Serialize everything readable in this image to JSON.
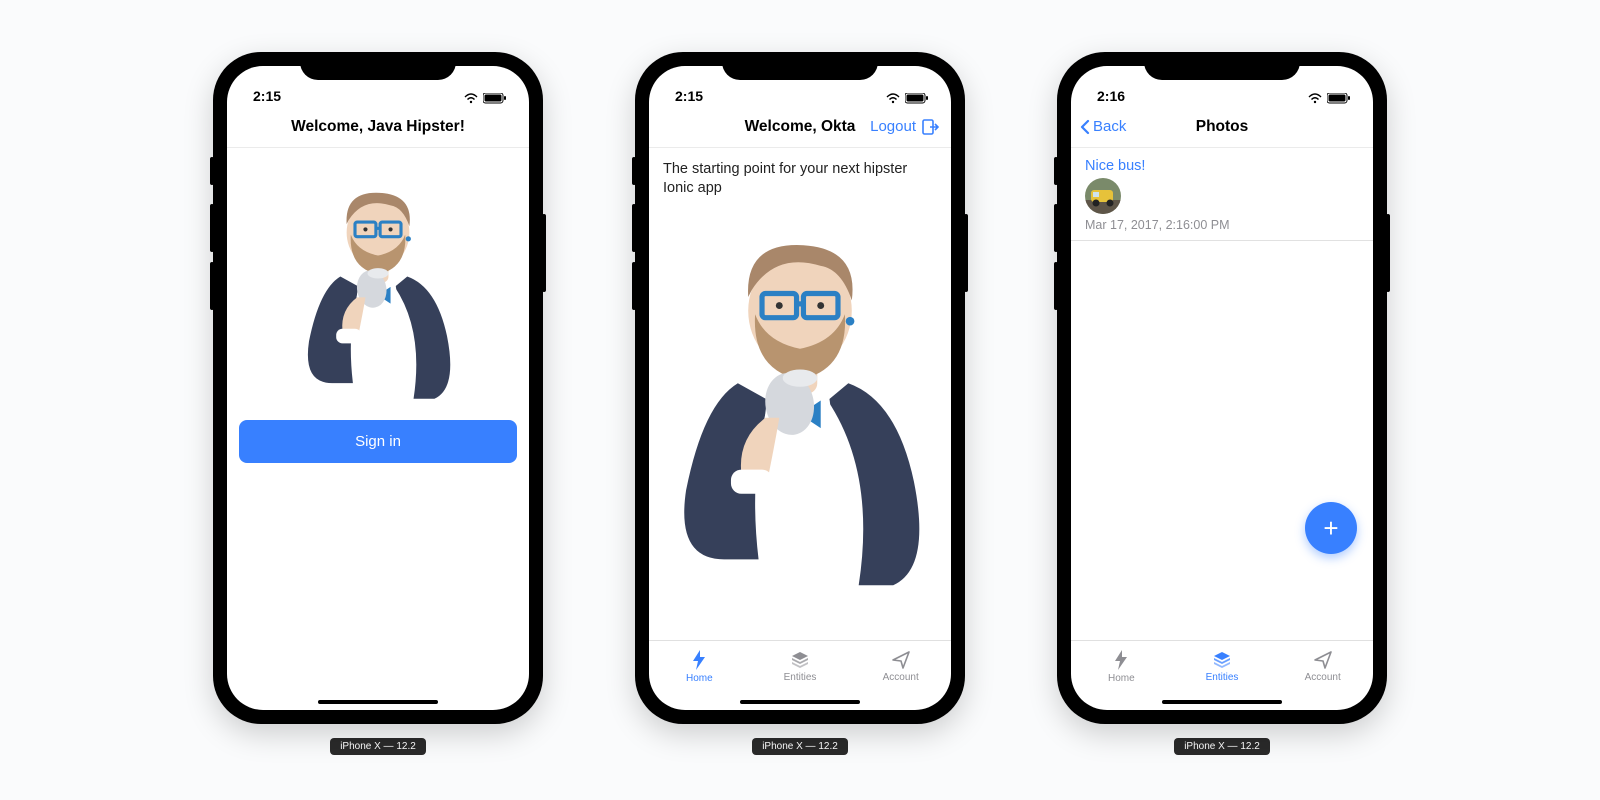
{
  "colors": {
    "accent": "#3880ff",
    "muted": "#8e8e93"
  },
  "device_label": "iPhone X — 12.2",
  "status": {
    "time_a": "2:15",
    "time_b": "2:15",
    "time_c": "2:16"
  },
  "screen1": {
    "title": "Welcome, Java Hipster!",
    "signin_label": "Sign in"
  },
  "screen2": {
    "title": "Welcome, Okta",
    "logout_label": "Logout",
    "subtitle": "The starting point for your next hipster Ionic app",
    "tabs": {
      "home": "Home",
      "entities": "Entities",
      "account": "Account"
    },
    "active_tab": "home"
  },
  "screen3": {
    "back_label": "Back",
    "title": "Photos",
    "item": {
      "title": "Nice bus!",
      "timestamp": "Mar 17, 2017, 2:16:00 PM"
    },
    "fab_label": "+",
    "tabs": {
      "home": "Home",
      "entities": "Entities",
      "account": "Account"
    },
    "active_tab": "entities"
  }
}
